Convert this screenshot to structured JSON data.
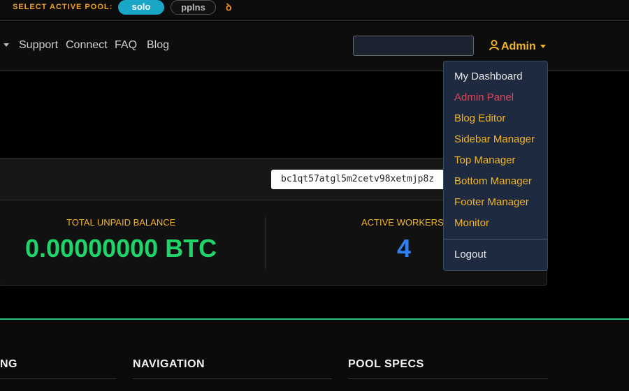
{
  "pool_bar": {
    "label": "SELECT ACTIVE POOL:",
    "options": [
      "solo",
      "pplns"
    ],
    "selected": "solo",
    "logo_glyph": "ꝺ"
  },
  "nav": {
    "links": [
      "Support",
      "Connect",
      "FAQ",
      "Blog"
    ],
    "search_value": "",
    "user_menu_label": "Admin"
  },
  "account": {
    "address": "bc1qt57atgl5m2cetv98xetmjp8z",
    "stats": [
      {
        "label": "TOTAL UNPAID BALANCE",
        "value": "0.00000000 BTC",
        "color": "#21d46a"
      },
      {
        "label": "ACTIVE WORKERS",
        "value": "4",
        "color": "#2f7ff2"
      }
    ]
  },
  "footer": {
    "headings": [
      "NG",
      "NAVIGATION",
      "POOL SPECS"
    ]
  },
  "user_dropdown": {
    "items": [
      {
        "label": "My Dashboard",
        "style": "white"
      },
      {
        "label": "Admin Panel",
        "style": "red"
      },
      {
        "label": "Blog Editor",
        "style": "gold"
      },
      {
        "label": "Sidebar Manager",
        "style": "gold"
      },
      {
        "label": "Top Manager",
        "style": "gold"
      },
      {
        "label": "Bottom Manager",
        "style": "gold"
      },
      {
        "label": "Footer Manager",
        "style": "gold"
      },
      {
        "label": "Monitor",
        "style": "gold"
      }
    ],
    "logout_label": "Logout"
  },
  "colors": {
    "accent_gold": "#f0b429",
    "pool_selected": "#1aa6c6",
    "footer_accent": "#2ec27e"
  }
}
